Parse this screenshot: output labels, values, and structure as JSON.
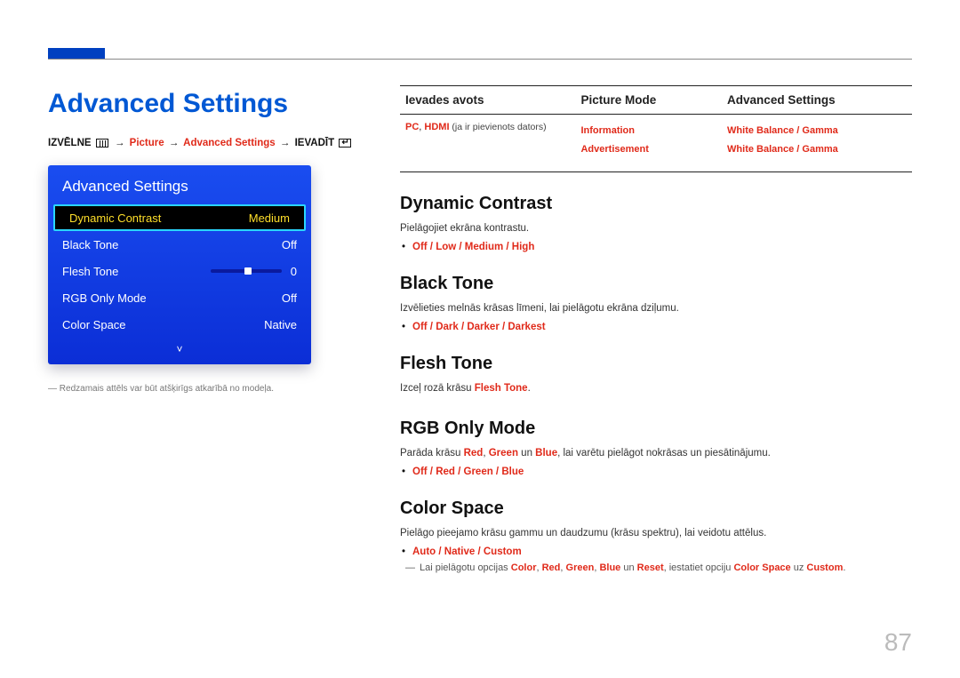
{
  "page": {
    "title": "Advanced Settings",
    "number": "87"
  },
  "breadcrumb": {
    "prefix": "IZVĒLNE",
    "path1": "Picture",
    "path2": "Advanced Settings",
    "suffix": "IEVADĪT"
  },
  "osd": {
    "title": "Advanced Settings",
    "rows": [
      {
        "label": "Dynamic Contrast",
        "value": "Medium",
        "selected": true
      },
      {
        "label": "Black Tone",
        "value": "Off"
      },
      {
        "label": "Flesh Tone",
        "value": "0",
        "slider": true
      },
      {
        "label": "RGB Only Mode",
        "value": "Off"
      },
      {
        "label": "Color Space",
        "value": "Native"
      }
    ],
    "down": "˅"
  },
  "footnote": "Redzamais attēls var būt atšķirīgs atkarībā no modeļa.",
  "table": {
    "headers": [
      "Ievades avots",
      "Picture Mode",
      "Advanced Settings"
    ],
    "col1": {
      "line1a": "PC",
      "line1b": "HDMI",
      "line1c": " (ja ir pievienots dators)"
    },
    "col2": [
      "Information",
      "Advertisement"
    ],
    "col3": [
      "White Balance / Gamma",
      "White Balance / Gamma"
    ]
  },
  "sections": [
    {
      "title": "Dynamic Contrast",
      "desc": "Pielāgojiet ekrāna kontrastu.",
      "options": "Off / Low / Medium / High"
    },
    {
      "title": "Black Tone",
      "desc": "Izvēlieties melnās krāsas līmeni, lai pielāgotu ekrāna dziļumu.",
      "options": "Off / Dark / Darker / Darkest"
    },
    {
      "title": "Flesh Tone",
      "desc_pre": "Izceļ rozā krāsu ",
      "desc_em": "Flesh Tone",
      "desc_post": "."
    },
    {
      "title": "RGB Only Mode",
      "desc_pre": "Parāda krāsu ",
      "desc_mid": " un ",
      "desc_post": ", lai varētu pielāgot nokrāsas un piesātinājumu.",
      "c1": "Red",
      "c2": "Green",
      "c3": "Blue",
      "options": "Off / Red / Green / Blue"
    },
    {
      "title": "Color Space",
      "desc": "Pielāgo pieejamo krāsu gammu un daudzumu (krāsu spektru), lai veidotu attēlus.",
      "options": "Auto / Native / Custom",
      "note_pre": "Lai pielāgotu opcijas ",
      "note_mid": " un ",
      "note_setopt": ", iestatiet opciju ",
      "note_to": " uz ",
      "n1": "Color",
      "n2": "Red",
      "n3": "Green",
      "n4": "Blue",
      "n5": "Reset",
      "n6": "Color Space",
      "n7": "Custom",
      "note_end": "."
    }
  ]
}
